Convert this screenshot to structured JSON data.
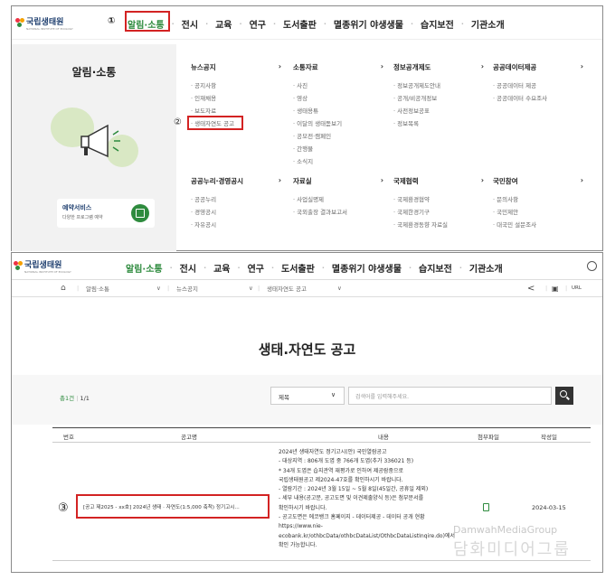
{
  "colors": {
    "accent": "#2e8b3e",
    "highlight": "#d32323",
    "dark": "#333333"
  },
  "logo_text": "국립생태원",
  "logo_sub": "NATIONAL INSTITUTE OF ECOLOGY",
  "step_markers": {
    "one": "①",
    "two": "②",
    "three": "③"
  },
  "top_menu": [
    "알림·소통",
    "전시",
    "교육",
    "연구",
    "도서출판",
    "멸종위기 야생생물",
    "습지보전",
    "기관소개"
  ],
  "mega_menu": {
    "left_title": "알림·소통",
    "reservation_title": "예약서비스",
    "reservation_sub": "다양한 프로그램 예약",
    "columns": [
      {
        "title": "뉴스공지",
        "items": [
          "공지사항",
          "인재채용",
          "보도자료",
          "생태자연도 공고"
        ]
      },
      {
        "title": "소통자료",
        "items": [
          "사진",
          "영상",
          "생태용튜",
          "이달의 생태돋보기",
          "공모전·캠페인",
          "간행물",
          "소식지"
        ]
      },
      {
        "title": "정보공개제도",
        "items": [
          "정보공개제도안내",
          "공개/비공개정보",
          "사전정보공표",
          "정보목록"
        ]
      },
      {
        "title": "공공데이터제공",
        "items": [
          "공공데이터 제공",
          "공공데이터 수요조사"
        ]
      },
      {
        "title": "공공누리·경영공시",
        "items": [
          "공공누리",
          "경영공시",
          "자유공시"
        ]
      },
      {
        "title": "자료실",
        "items": [
          "사업실명제",
          "국외출장 결과보고서"
        ]
      },
      {
        "title": "국제협력",
        "items": [
          "국제환경협약",
          "국제한경기구",
          "국제환경동향 자료실"
        ]
      },
      {
        "title": "국민참여",
        "items": [
          "문의사항",
          "국민제안",
          "대국민 설문조사"
        ]
      }
    ],
    "arrow": "›"
  },
  "subbar": {
    "home_icon": "home-icon",
    "crumbs": [
      "알림·소통",
      "뉴스공지",
      "생태자연도 공고"
    ],
    "chevron": "∨",
    "url_label": "URL"
  },
  "page_title": "생태.자연도 공고",
  "search": {
    "total_label": "총1건",
    "page_label": "1/1",
    "select_value": "제목",
    "placeholder": "검색어를 입력해주세요."
  },
  "table": {
    "headers": [
      "번호",
      "공고명",
      "내용",
      "첨부파일",
      "작성일"
    ],
    "row": {
      "title": "[공고 제2025 - xx호] 2024년 생태 · 자연도(1:5,000 축척) 정기고시...",
      "content_lines": [
        "2024년 생태자연도 정기고시(안) 국민열람공고",
        "- 대상지역 : 806개 도엽 중 766개 도엽(추가 336021 등)",
        "* 34개 도엽은 습지관역 재평가로 인하여 제공람중으로",
        "국립생태원공고 제2024-47호를 확인하시기 바랍니다.",
        "- 열람기간 : 2024년 3월 15일 ~ 5월 8일(45일간, 공휴일 제외)",
        "- 세부 내용(공고문, 공고도면 및 이견제출양식 등)은 첨부문서를",
        "확인하시기 바랍니다.",
        "- 공고도면은 에코뱅크 홈페이지 - 데이터제공 - 데이터 공개 현황",
        "https://www.nie-",
        "ecobank.kr/othbcData/othbcDataList/OthbcDataListInqire.do)에서",
        "확인 가능합니다."
      ],
      "date": "2024-03-15"
    }
  },
  "watermark": {
    "en": "DamwahMediaGroup",
    "ko": "담화미디어그룹"
  }
}
